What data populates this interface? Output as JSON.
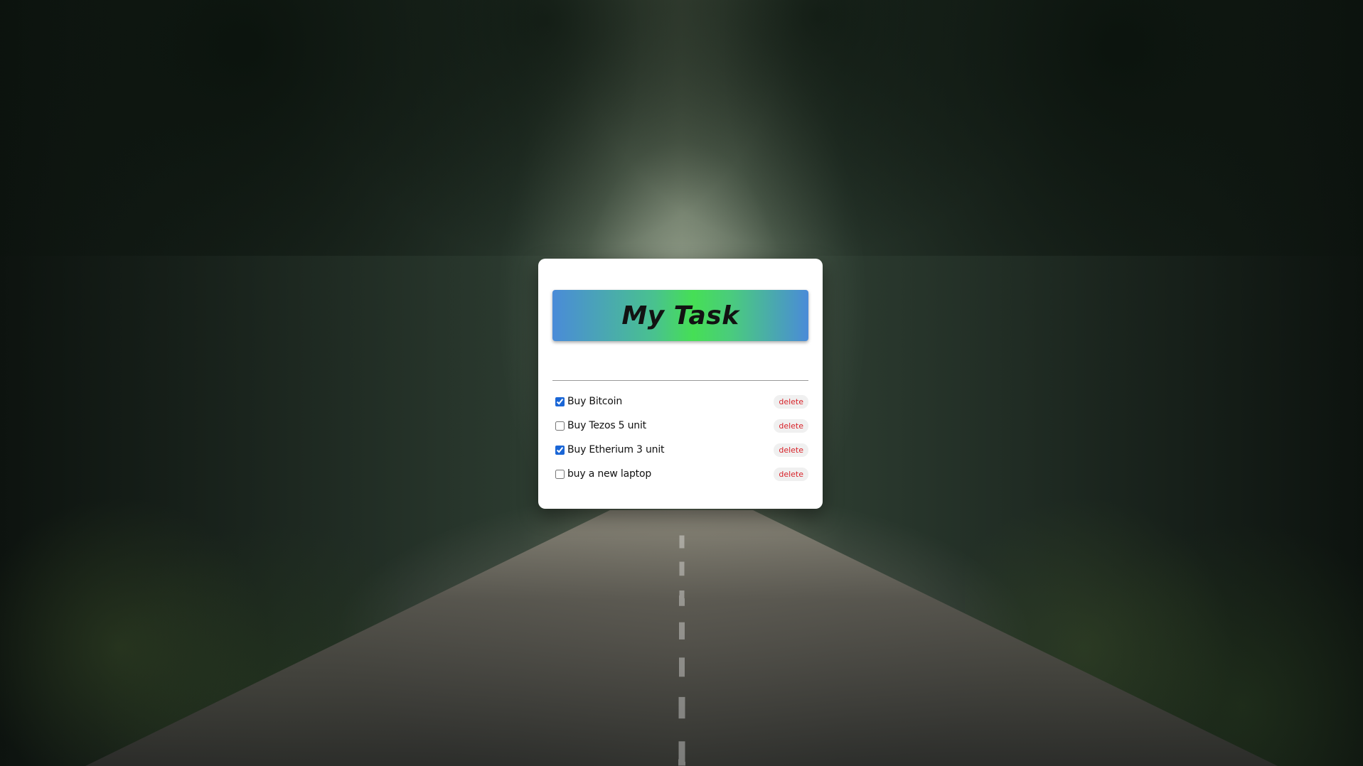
{
  "app": {
    "title": "My Task"
  },
  "input": {
    "value": "",
    "placeholder": ""
  },
  "tasks": [
    {
      "label": "Buy Bitcoin",
      "checked": true,
      "delete_label": "delete"
    },
    {
      "label": "Buy Tezos 5 unit",
      "checked": false,
      "delete_label": "delete"
    },
    {
      "label": "Buy Etherium 3 unit",
      "checked": true,
      "delete_label": "delete"
    },
    {
      "label": "buy a new laptop",
      "checked": false,
      "delete_label": "delete"
    }
  ],
  "colors": {
    "banner_start": "#4a8bd8",
    "banner_mid": "#46df55",
    "delete_text": "#d8232a",
    "checkbox_accent": "#1a66d6"
  }
}
